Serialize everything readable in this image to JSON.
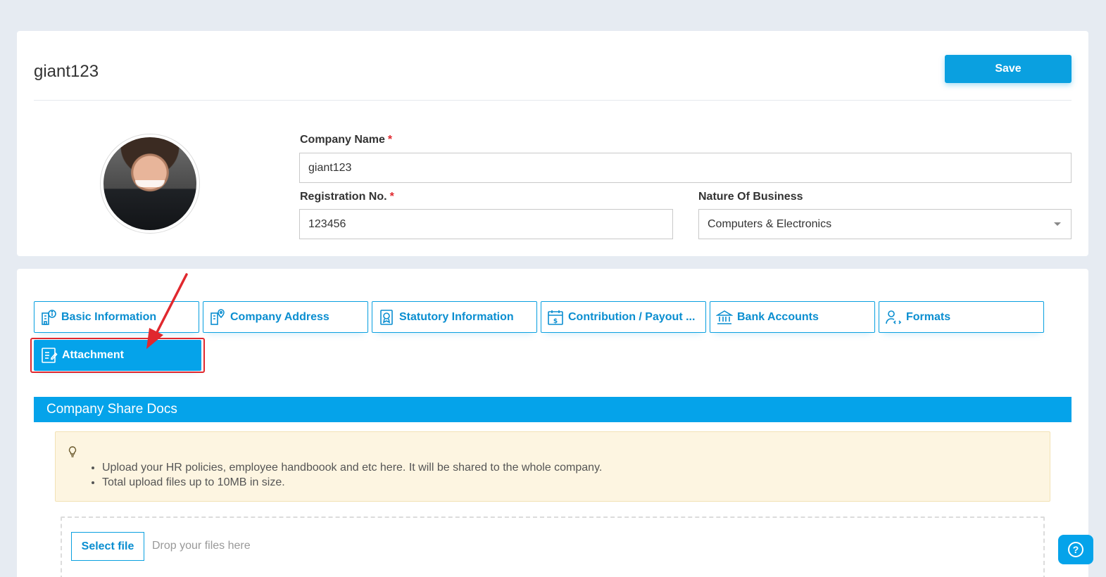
{
  "header": {
    "title": "giant123",
    "save_label": "Save"
  },
  "form": {
    "company_name_label": "Company Name",
    "company_name_value": "giant123",
    "registration_label": "Registration No.",
    "registration_value": "123456",
    "nature_label": "Nature Of Business",
    "nature_value": "Computers & Electronics",
    "required_mark": "*"
  },
  "tabs": [
    {
      "label": "Basic Information",
      "icon": "building-info-icon"
    },
    {
      "label": "Company Address",
      "icon": "building-pin-icon"
    },
    {
      "label": "Statutory Information",
      "icon": "certificate-icon"
    },
    {
      "label": "Contribution / Payout ...",
      "icon": "calendar-dollar-icon"
    },
    {
      "label": "Bank Accounts",
      "icon": "bank-icon"
    },
    {
      "label": "Formats",
      "icon": "user-code-icon"
    },
    {
      "label": "Attachment",
      "icon": "document-edit-icon",
      "active": true
    }
  ],
  "section": {
    "title": "Company Share Docs"
  },
  "info": {
    "bullets": [
      "Upload your HR policies, employee handboook and etc here. It will be shared to the whole company.",
      "Total upload files up to 10MB in size."
    ]
  },
  "upload": {
    "button_label": "Select file",
    "drop_text": "Drop your files here"
  },
  "help": {
    "icon": "help-icon",
    "label": "?"
  },
  "colors": {
    "accent": "#05a3ea",
    "highlight": "#e0282e",
    "info_bg": "#fdf5e1"
  }
}
